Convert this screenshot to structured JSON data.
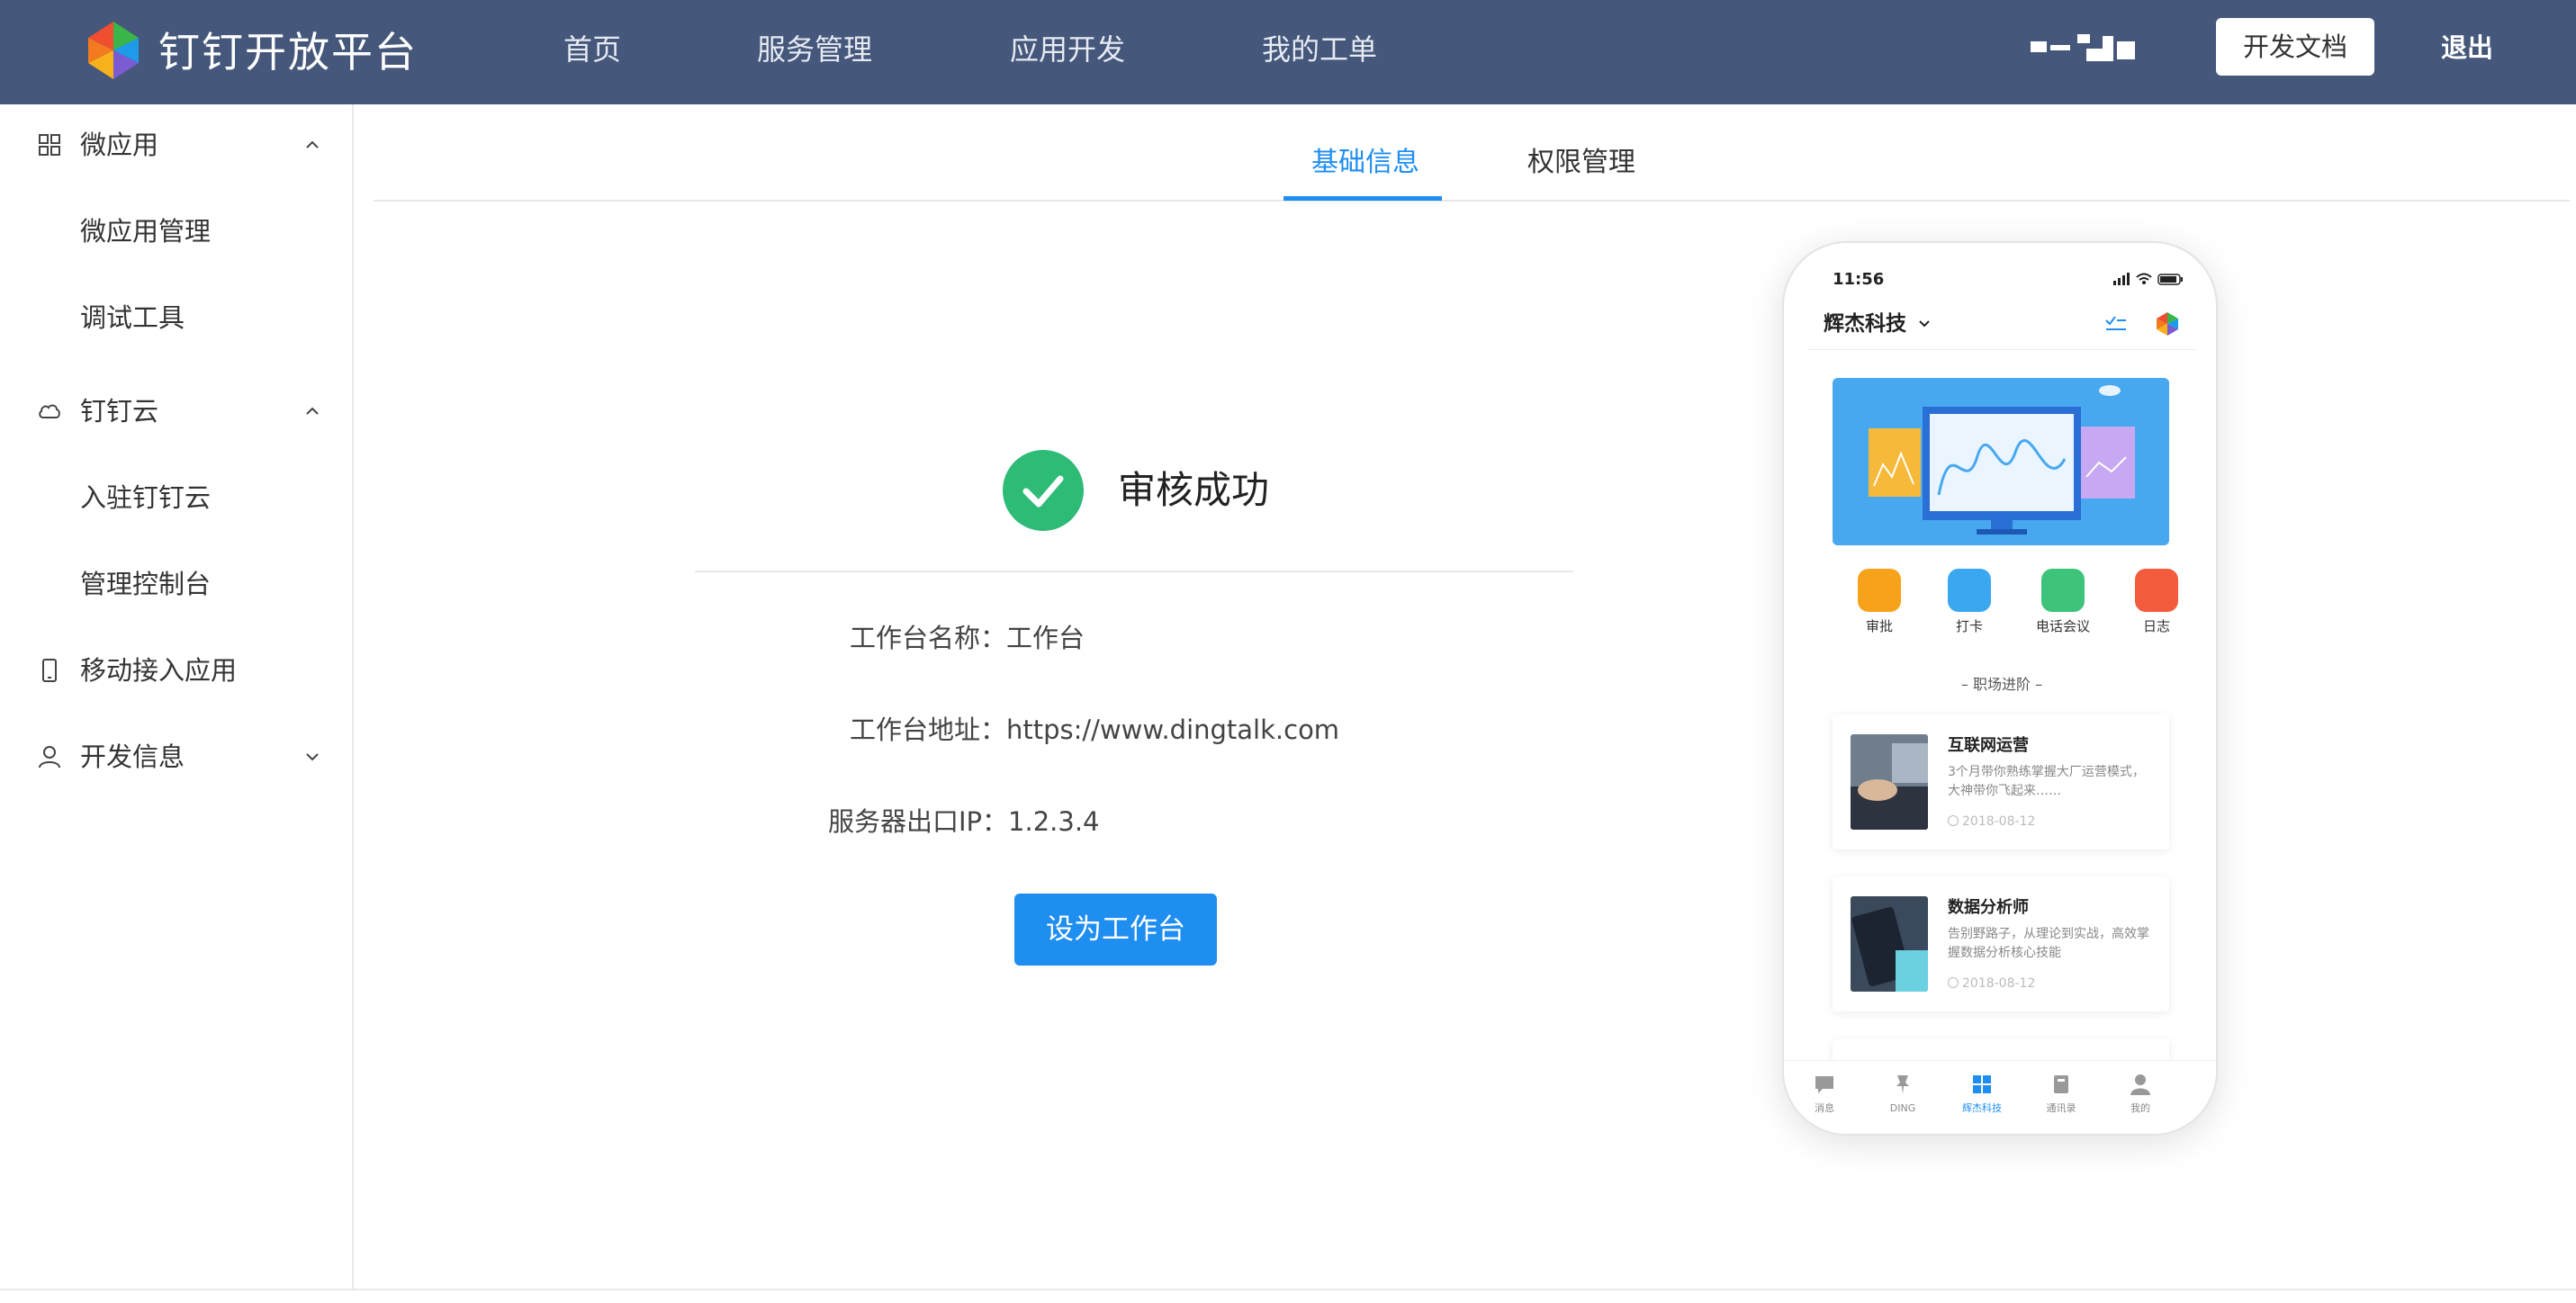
{
  "header": {
    "brand": "钉钉开放平台",
    "nav": [
      "首页",
      "服务管理",
      "应用开发",
      "我的工单"
    ],
    "doc_button": "开发文档",
    "logout": "退出"
  },
  "sidebar": {
    "groups": [
      {
        "label": "微应用",
        "icon": "grid-icon",
        "expanded": true,
        "items": [
          "微应用管理",
          "调试工具"
        ]
      },
      {
        "label": "钉钉云",
        "icon": "cloud-icon",
        "expanded": true,
        "items": [
          "入驻钉钉云",
          "管理控制台"
        ]
      },
      {
        "label": "移动接入应用",
        "icon": "mobile-icon"
      },
      {
        "label": "开发信息",
        "icon": "user-icon",
        "expanded": false
      }
    ]
  },
  "tabs": [
    "基础信息",
    "权限管理"
  ],
  "result": {
    "title": "审核成功",
    "workbench_name": "工作台名称：工作台",
    "workbench_url": "工作台地址：https://www.dingtalk.com",
    "server_ip": "服务器出口IP：1.2.3.4",
    "button": "设为工作台"
  },
  "phone": {
    "time": "11:56",
    "company": "辉杰科技",
    "apps": [
      {
        "label": "审批",
        "color": "#f7a21b"
      },
      {
        "label": "打卡",
        "color": "#3aa8f0"
      },
      {
        "label": "电话会议",
        "color": "#3dc47a"
      },
      {
        "label": "日志",
        "color": "#f25b3b"
      }
    ],
    "section_title": "– 职场进阶 –",
    "cards": [
      {
        "title": "互联网运营",
        "desc": "3个月带你熟练掌握大厂运营模式，大神带你飞起来……",
        "date": "2018-08-12"
      },
      {
        "title": "数据分析师",
        "desc": "告别野路子，从理论到实战，高效掌握数据分析核心技能",
        "date": "2018-08-12"
      }
    ],
    "tabbar": [
      "消息",
      "DING",
      "辉杰科技",
      "通讯录",
      "我的"
    ]
  }
}
